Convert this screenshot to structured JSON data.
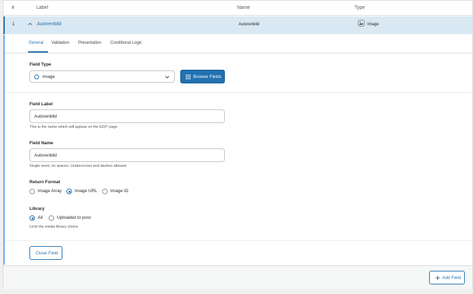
{
  "table_header": {
    "index": "#",
    "label": "Label",
    "name": "Name",
    "type": "Type"
  },
  "field_row": {
    "index": "1",
    "label": "Autorenbild",
    "name": "Autorenbild",
    "type": "Image",
    "type_icon": "image-icon",
    "expand_icon": "chevron-up-icon"
  },
  "tabs": [
    {
      "label": "General",
      "active": true
    },
    {
      "label": "Validation",
      "active": false
    },
    {
      "label": "Presentation",
      "active": false
    },
    {
      "label": "Conditional Logic",
      "active": false
    }
  ],
  "field_type": {
    "label": "Field Type",
    "value": "Image",
    "browse_button": "Browse Fields"
  },
  "field_label": {
    "label": "Field Label",
    "value": "Autorenbild",
    "hint": "This is the name which will appear on the EDIT page"
  },
  "field_name": {
    "label": "Field Name",
    "value": "Autorenbild",
    "hint": "Single word, no spaces. Underscores and dashes allowed"
  },
  "return_format": {
    "label": "Return Format",
    "options": [
      {
        "label": "Image Array",
        "checked": false
      },
      {
        "label": "Image URL",
        "checked": true
      },
      {
        "label": "Image ID",
        "checked": false
      }
    ]
  },
  "library": {
    "label": "Library",
    "options": [
      {
        "label": "All",
        "checked": true
      },
      {
        "label": "Uploaded to post",
        "checked": false
      }
    ],
    "hint": "Limit the media library choice"
  },
  "close_field_button": "Close Field",
  "add_field_button": "Add Field",
  "colors": {
    "accent": "#2271b1",
    "row_highlight": "#d9e8f3",
    "border": "#dcdcde"
  }
}
